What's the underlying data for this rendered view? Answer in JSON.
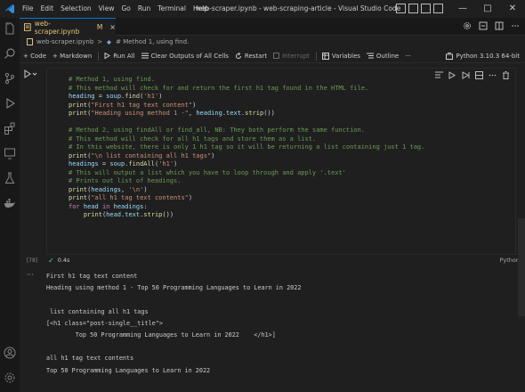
{
  "titlebar": {
    "menu": [
      "File",
      "Edit",
      "Selection",
      "View",
      "Go",
      "Run",
      "Terminal",
      "Help"
    ],
    "title": "web-scraper.ipynb - web-scraping-article - Visual Studio Code",
    "controls": [
      "—",
      "□",
      "✕"
    ]
  },
  "tab": {
    "name": "web-scraper.ipynb",
    "modified": "M",
    "close": "×"
  },
  "breadcrumb": {
    "file": "web-scraper.ipynb",
    "sep": ">",
    "section": "# Method 1, using find."
  },
  "toolbar": {
    "code": "+ Code",
    "markdown": "+ Markdown",
    "run_all": "Run All",
    "clear": "Clear Outputs of All Cells",
    "restart": "Restart",
    "interrupt": "Interrupt",
    "variables": "Variables",
    "outline": "Outline",
    "more": "···",
    "kernel": "Python 3.10.3 64-bit"
  },
  "cell": {
    "exec_count": "[78]",
    "duration": "0.4s",
    "language": "Python",
    "code": [
      [
        [
          "cm",
          "# Method 1, using find."
        ]
      ],
      [
        [
          "cm",
          "# This method will check for and return the first h1 tag found in the HTML file."
        ]
      ],
      [
        [
          "var",
          "heading"
        ],
        [
          "op",
          " = "
        ],
        [
          "var",
          "soup"
        ],
        [
          "op",
          "."
        ],
        [
          "fn",
          "find"
        ],
        [
          "op",
          "("
        ],
        [
          "st",
          "'h1'"
        ],
        [
          "op",
          ")"
        ]
      ],
      [
        [
          "fn",
          "print"
        ],
        [
          "op",
          "("
        ],
        [
          "st",
          "\"First h1 tag text content\""
        ],
        [
          "op",
          ")"
        ]
      ],
      [
        [
          "fn",
          "print"
        ],
        [
          "op",
          "("
        ],
        [
          "st",
          "\"Heading using method 1 -\""
        ],
        [
          "op",
          ", "
        ],
        [
          "var",
          "heading"
        ],
        [
          "op",
          "."
        ],
        [
          "var",
          "text"
        ],
        [
          "op",
          "."
        ],
        [
          "fn",
          "strip"
        ],
        [
          "op",
          "())"
        ]
      ],
      [
        [
          "pl",
          ""
        ]
      ],
      [
        [
          "cm",
          "# Method 2, using findAll or find_all, NB: They both perform the same function."
        ]
      ],
      [
        [
          "cm",
          "# This method will check for all h1 tags and store them as a list."
        ]
      ],
      [
        [
          "cm",
          "# In this website, there is only 1 h1 tag so it will be returning a list containing just 1 tag."
        ]
      ],
      [
        [
          "fn",
          "print"
        ],
        [
          "op",
          "("
        ],
        [
          "st",
          "\"\\n list containing all h1 tags\""
        ],
        [
          "op",
          ")"
        ]
      ],
      [
        [
          "var",
          "headings"
        ],
        [
          "op",
          " = "
        ],
        [
          "var",
          "soup"
        ],
        [
          "op",
          "."
        ],
        [
          "fn",
          "findAll"
        ],
        [
          "op",
          "("
        ],
        [
          "st",
          "'h1'"
        ],
        [
          "op",
          ")"
        ]
      ],
      [
        [
          "cm",
          "# This will output a list which you have to loop through and apply '.text'"
        ]
      ],
      [
        [
          "cm",
          "# Prints out list of headings."
        ]
      ],
      [
        [
          "fn",
          "print"
        ],
        [
          "op",
          "("
        ],
        [
          "var",
          "headings"
        ],
        [
          "op",
          ", "
        ],
        [
          "st",
          "'\\n'"
        ],
        [
          "op",
          ")"
        ]
      ],
      [
        [
          "fn",
          "print"
        ],
        [
          "op",
          "("
        ],
        [
          "st",
          "\"all h1 tag text contents\""
        ],
        [
          "op",
          ")"
        ]
      ],
      [
        [
          "kw",
          "for"
        ],
        [
          "op",
          " "
        ],
        [
          "var",
          "head"
        ],
        [
          "op",
          " "
        ],
        [
          "kw",
          "in"
        ],
        [
          "op",
          " "
        ],
        [
          "var",
          "headings"
        ],
        [
          "op",
          ":"
        ]
      ],
      [
        [
          "op",
          "    "
        ],
        [
          "fn",
          "print"
        ],
        [
          "op",
          "("
        ],
        [
          "var",
          "head"
        ],
        [
          "op",
          "."
        ],
        [
          "var",
          "text"
        ],
        [
          "op",
          "."
        ],
        [
          "fn",
          "strip"
        ],
        [
          "op",
          "())"
        ]
      ]
    ]
  },
  "output": {
    "lines": [
      "First h1 tag text content",
      "Heading using method 1 - Top 50 Programming Languages to Learn in 2022",
      "",
      " list containing all h1 tags",
      "[<h1 class=\"post-single__title\">",
      "        Top 50 Programming Languages to Learn in 2022    </h1>]",
      "",
      "all h1 tag text contents",
      "Top 50 Programming Languages to Learn in 2022"
    ]
  },
  "colors": {
    "accent": "#0078d4",
    "success": "#73c991",
    "modified": "#e6c07b"
  }
}
